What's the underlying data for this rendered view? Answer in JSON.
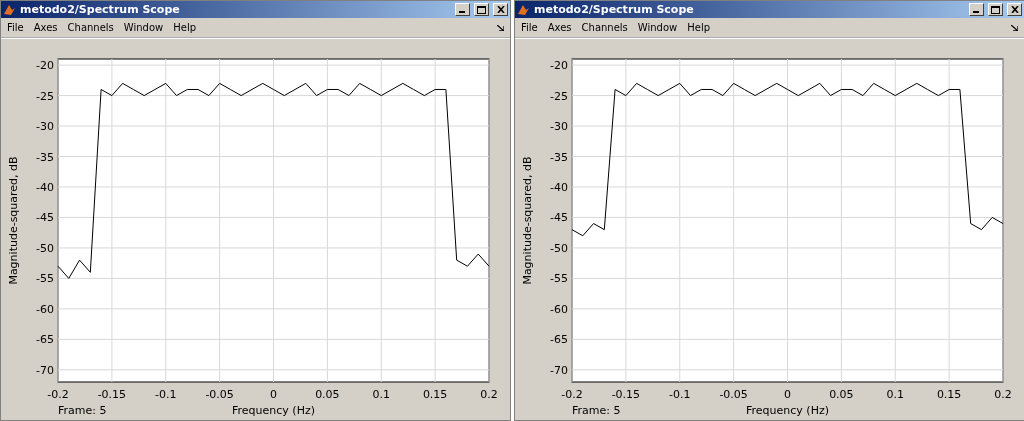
{
  "windows": [
    {
      "title": "metodo2/Spectrum Scope",
      "menu": [
        "File",
        "Axes",
        "Channels",
        "Window",
        "Help"
      ],
      "frame_label": "Frame: 5",
      "chart_data": {
        "type": "line",
        "xlabel": "Frequency (Hz)",
        "ylabel": "Magnitude-squared, dB",
        "grid": true,
        "xlim": [
          -0.2,
          0.2
        ],
        "ylim": [
          -72,
          -19
        ],
        "xticks": [
          {
            "value": -0.2,
            "label": "-0.2"
          },
          {
            "value": -0.15,
            "label": "-0.15"
          },
          {
            "value": -0.1,
            "label": "-0.1"
          },
          {
            "value": -0.05,
            "label": "-0.05"
          },
          {
            "value": 0,
            "label": "0"
          },
          {
            "value": 0.05,
            "label": "0.05"
          },
          {
            "value": 0.1,
            "label": "0.1"
          },
          {
            "value": 0.15,
            "label": "0.15"
          },
          {
            "value": 0.2,
            "label": "0.2"
          }
        ],
        "yticks": [
          -20,
          -25,
          -30,
          -35,
          -40,
          -45,
          -50,
          -55,
          -60,
          -65,
          -70
        ],
        "x": [
          -0.2,
          -0.19,
          -0.18,
          -0.17,
          -0.16,
          -0.15,
          -0.14,
          -0.13,
          -0.12,
          -0.11,
          -0.1,
          -0.09,
          -0.08,
          -0.07,
          -0.06,
          -0.05,
          -0.04,
          -0.03,
          -0.02,
          -0.01,
          0,
          0.01,
          0.02,
          0.03,
          0.04,
          0.05,
          0.06,
          0.07,
          0.08,
          0.09,
          0.1,
          0.11,
          0.12,
          0.13,
          0.14,
          0.15,
          0.16,
          0.17,
          0.18,
          0.19,
          0.2
        ],
        "series": [
          {
            "color": "#000000",
            "values": [
              -53,
              -55,
              -52,
              -54,
              -24,
              -25,
              -23,
              -24,
              -25,
              -24,
              -23,
              -25,
              -24,
              -24,
              -25,
              -23,
              -24,
              -25,
              -24,
              -23,
              -24,
              -25,
              -24,
              -23,
              -25,
              -24,
              -24,
              -25,
              -23,
              -24,
              -25,
              -24,
              -23,
              -24,
              -25,
              -24,
              -24,
              -52,
              -53,
              -51,
              -53
            ]
          }
        ]
      }
    },
    {
      "title": "metodo2/Spectrum Scope",
      "menu": [
        "File",
        "Axes",
        "Channels",
        "Window",
        "Help"
      ],
      "frame_label": "Frame: 5",
      "chart_data": {
        "type": "line",
        "xlabel": "Frequency (Hz)",
        "ylabel": "Magnitude-squared, dB",
        "grid": true,
        "xlim": [
          -0.2,
          0.2
        ],
        "ylim": [
          -72,
          -19
        ],
        "xticks": [
          {
            "value": -0.2,
            "label": "-0.2"
          },
          {
            "value": -0.15,
            "label": "-0.15"
          },
          {
            "value": -0.1,
            "label": "-0.1"
          },
          {
            "value": -0.05,
            "label": "-0.05"
          },
          {
            "value": 0,
            "label": "0"
          },
          {
            "value": 0.05,
            "label": "0.05"
          },
          {
            "value": 0.1,
            "label": "0.1"
          },
          {
            "value": 0.15,
            "label": "0.15"
          },
          {
            "value": 0.2,
            "label": "0.2"
          }
        ],
        "yticks": [
          -20,
          -25,
          -30,
          -35,
          -40,
          -45,
          -50,
          -55,
          -60,
          -65,
          -70
        ],
        "x": [
          -0.2,
          -0.19,
          -0.18,
          -0.17,
          -0.16,
          -0.15,
          -0.14,
          -0.13,
          -0.12,
          -0.11,
          -0.1,
          -0.09,
          -0.08,
          -0.07,
          -0.06,
          -0.05,
          -0.04,
          -0.03,
          -0.02,
          -0.01,
          0,
          0.01,
          0.02,
          0.03,
          0.04,
          0.05,
          0.06,
          0.07,
          0.08,
          0.09,
          0.1,
          0.11,
          0.12,
          0.13,
          0.14,
          0.15,
          0.16,
          0.17,
          0.18,
          0.19,
          0.2
        ],
        "series": [
          {
            "color": "#000000",
            "values": [
              -47,
              -48,
              -46,
              -47,
              -24,
              -25,
              -23,
              -24,
              -25,
              -24,
              -23,
              -25,
              -24,
              -24,
              -25,
              -23,
              -24,
              -25,
              -24,
              -23,
              -24,
              -25,
              -24,
              -23,
              -25,
              -24,
              -24,
              -25,
              -23,
              -24,
              -25,
              -24,
              -23,
              -24,
              -25,
              -24,
              -24,
              -46,
              -47,
              -45,
              -46
            ]
          }
        ]
      }
    }
  ]
}
